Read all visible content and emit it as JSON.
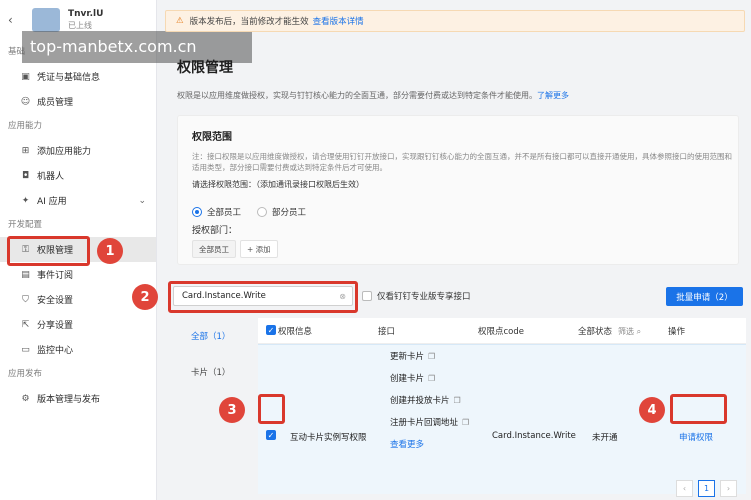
{
  "app": {
    "name": "Tnvr.lU",
    "status": "已上线"
  },
  "watermark": "top-manbetx.com.cn",
  "sidebar": {
    "groups": [
      {
        "label": "基础",
        "items": [
          {
            "label": "凭证与基础信息",
            "icon": "credential-icon"
          },
          {
            "label": "成员管理",
            "icon": "person-icon"
          }
        ]
      },
      {
        "label": "应用能力",
        "items": [
          {
            "label": "添加应用能力",
            "icon": "grid-icon"
          },
          {
            "label": "机器人",
            "icon": "robot-icon"
          },
          {
            "label": "AI 应用",
            "icon": "ai-icon"
          }
        ]
      },
      {
        "label": "开发配置",
        "items": [
          {
            "label": "权限管理",
            "icon": "key-icon"
          },
          {
            "label": "事件订阅",
            "icon": "event-icon"
          },
          {
            "label": "安全设置",
            "icon": "shield-icon"
          },
          {
            "label": "分享设置",
            "icon": "share-icon"
          },
          {
            "label": "监控中心",
            "icon": "monitor-icon"
          }
        ]
      },
      {
        "label": "应用发布",
        "items": [
          {
            "label": "版本管理与发布",
            "icon": "version-icon"
          }
        ]
      }
    ]
  },
  "notice": {
    "text": "版本发布后，当前修改才能生效",
    "link": "查看版本详情"
  },
  "page": {
    "title": "权限管理",
    "desc": "权限是以应用维度做授权，实现与钉钉核心能力的全面互通，部分需要付费或达到特定条件才能使用。",
    "desc_link": "了解更多"
  },
  "scope": {
    "heading": "权限范围",
    "note": "注：接口权限是以应用维度做授权，请合理使用钉钉开放接口，实现跟钉钉核心能力的全面互通，并不是所有接口都可以直接开通使用，具体参照接口的使用范围和适用类型，部分接口需要付费或达到特定条件后才可使用。",
    "pick_label": "请选择权限范围：（添加通讯录接口权限后生效）",
    "radio_all": "全部员工",
    "radio_part": "部分员工",
    "dept_label": "授权部门：",
    "dept_chip": "全部员工",
    "add_label": "+ 添加"
  },
  "search": {
    "value": "Card.Instance.Write",
    "exclusive_label": "仅看钉钉专业版专享接口",
    "batch_label": "批量申请（2）"
  },
  "categories": [
    {
      "label": "全部（1）"
    },
    {
      "label": "卡片（1）"
    }
  ],
  "table": {
    "headers": {
      "info": "权限信息",
      "api": "接口",
      "code": "权限点code",
      "state": "全部状态",
      "filter": "筛选",
      "op": "操作"
    },
    "row": {
      "name": "互动卡片实例写权限",
      "apis": [
        "更新卡片",
        "创建卡片",
        "创建并投放卡片",
        "注册卡片回调地址"
      ],
      "more": "查看更多",
      "code": "Card.Instance.Write",
      "state": "未开通",
      "action": "申请权限"
    }
  },
  "pager": {
    "current": "1"
  },
  "markers": [
    "1",
    "2",
    "3",
    "4"
  ]
}
